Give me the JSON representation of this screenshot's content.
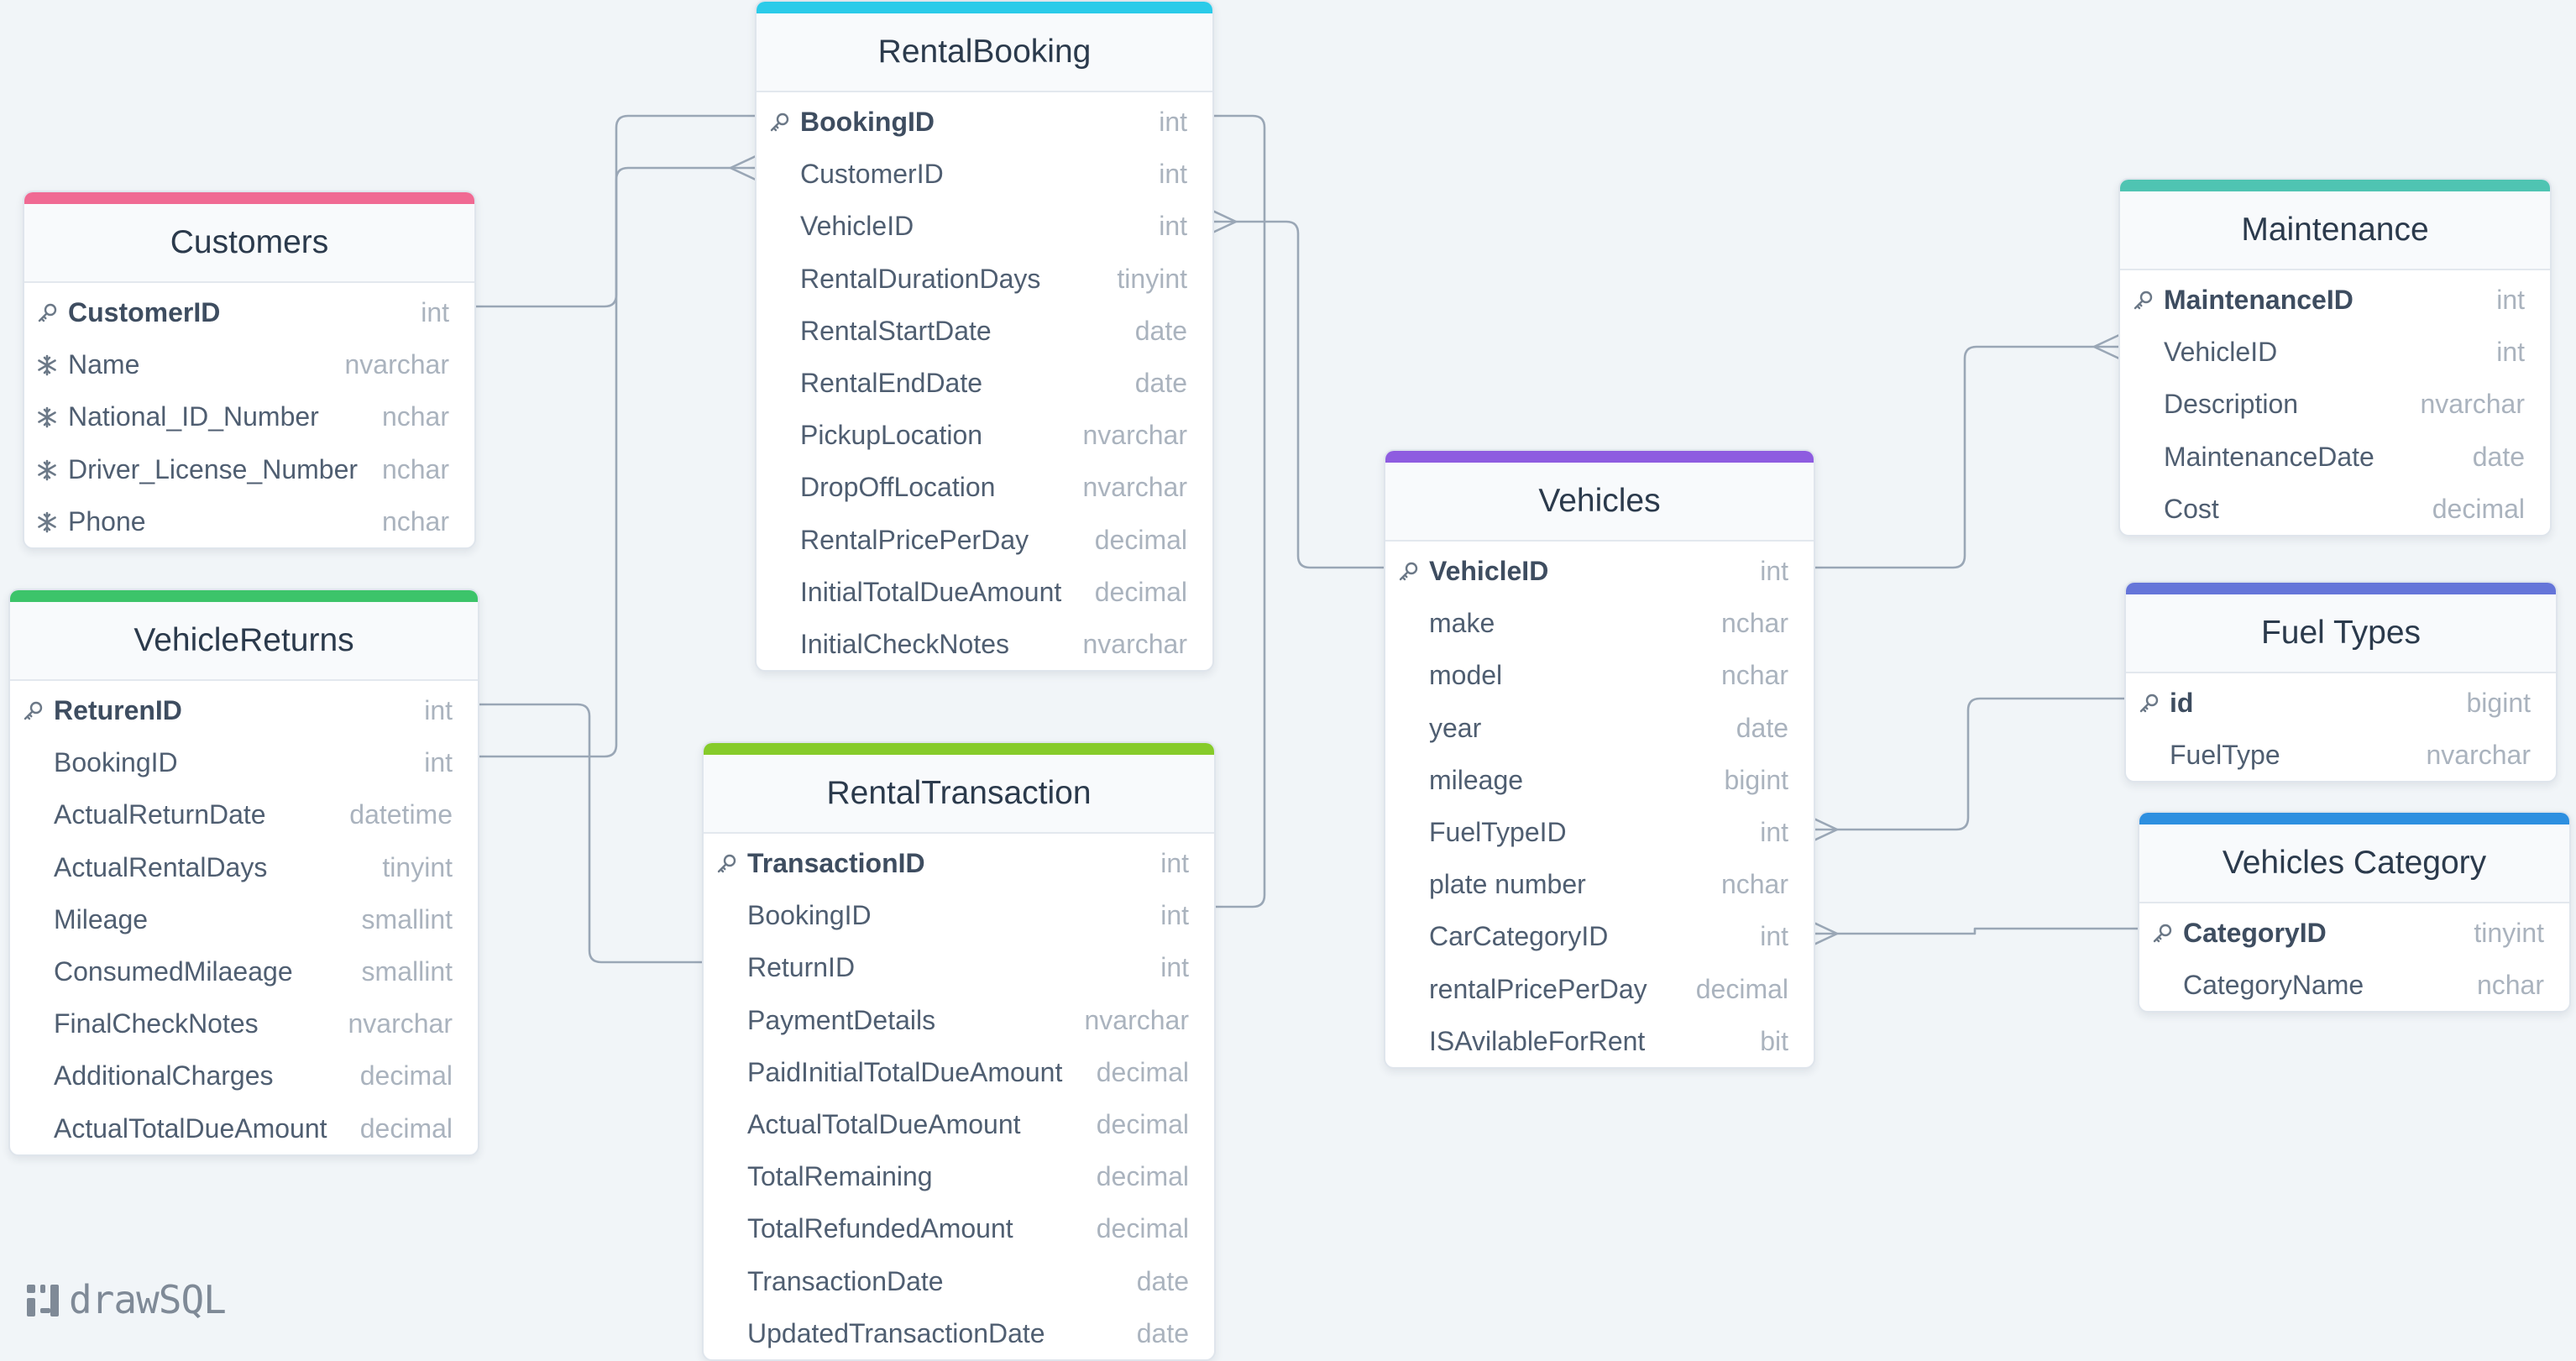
{
  "app": {
    "brand": "drawSQL"
  },
  "colors": {
    "customers": "#f06a93",
    "vehiclereturns": "#3cc46a",
    "rentalbooking": "#2bcbe9",
    "rentaltransaction": "#86cb2a",
    "vehicles": "#8e5ce0",
    "maintenance": "#4fc4b2",
    "fueltypes": "#6575d9",
    "vehiclescategory": "#2d8fe0",
    "connector": "#9aa7b6"
  },
  "tables": [
    {
      "id": "rentalbooking",
      "name": "RentalBooking",
      "fields": [
        {
          "name": "BookingID",
          "type": "int",
          "pk": true
        },
        {
          "name": "CustomerID",
          "type": "int"
        },
        {
          "name": "VehicleID",
          "type": "int"
        },
        {
          "name": "RentalDurationDays",
          "type": "tinyint"
        },
        {
          "name": "RentalStartDate",
          "type": "date"
        },
        {
          "name": "RentalEndDate",
          "type": "date"
        },
        {
          "name": "PickupLocation",
          "type": "nvarchar"
        },
        {
          "name": "DropOffLocation",
          "type": "nvarchar"
        },
        {
          "name": "RentalPricePerDay",
          "type": "decimal"
        },
        {
          "name": "InitialTotalDueAmount",
          "type": "decimal"
        },
        {
          "name": "InitialCheckNotes",
          "type": "nvarchar"
        }
      ]
    },
    {
      "id": "customers",
      "name": "Customers",
      "fields": [
        {
          "name": "CustomerID",
          "type": "int",
          "pk": true
        },
        {
          "name": "Name",
          "type": "nvarchar",
          "idx": true
        },
        {
          "name": "National_ID_Number",
          "type": "nchar",
          "idx": true
        },
        {
          "name": "Driver_License_Number",
          "type": "nchar",
          "idx": true
        },
        {
          "name": "Phone",
          "type": "nchar",
          "idx": true
        }
      ]
    },
    {
      "id": "vehiclereturns",
      "name": "VehicleReturns",
      "fields": [
        {
          "name": "ReturenID",
          "type": "int",
          "pk": true
        },
        {
          "name": "BookingID",
          "type": "int"
        },
        {
          "name": "ActualReturnDate",
          "type": "datetime"
        },
        {
          "name": "ActualRentalDays",
          "type": "tinyint"
        },
        {
          "name": "Mileage",
          "type": "smallint"
        },
        {
          "name": "ConsumedMilaeage",
          "type": "smallint"
        },
        {
          "name": "FinalCheckNotes",
          "type": "nvarchar"
        },
        {
          "name": "AdditionalCharges",
          "type": "decimal"
        },
        {
          "name": "ActualTotalDueAmount",
          "type": "decimal"
        }
      ]
    },
    {
      "id": "rentaltransaction",
      "name": "RentalTransaction",
      "fields": [
        {
          "name": "TransactionID",
          "type": "int",
          "pk": true
        },
        {
          "name": "BookingID",
          "type": "int"
        },
        {
          "name": "ReturnID",
          "type": "int"
        },
        {
          "name": "PaymentDetails",
          "type": "nvarchar"
        },
        {
          "name": "PaidInitialTotalDueAmount",
          "type": "decimal"
        },
        {
          "name": "ActualTotalDueAmount",
          "type": "decimal"
        },
        {
          "name": "TotalRemaining",
          "type": "decimal"
        },
        {
          "name": "TotalRefundedAmount",
          "type": "decimal"
        },
        {
          "name": "TransactionDate",
          "type": "date"
        },
        {
          "name": "UpdatedTransactionDate",
          "type": "date"
        }
      ]
    },
    {
      "id": "vehicles",
      "name": "Vehicles",
      "fields": [
        {
          "name": "VehicleID",
          "type": "int",
          "pk": true
        },
        {
          "name": "make",
          "type": "nchar"
        },
        {
          "name": "model",
          "type": "nchar"
        },
        {
          "name": "year",
          "type": "date"
        },
        {
          "name": "mileage",
          "type": "bigint"
        },
        {
          "name": "FuelTypeID",
          "type": "int"
        },
        {
          "name": "plate number",
          "type": "nchar"
        },
        {
          "name": "CarCategoryID",
          "type": "int"
        },
        {
          "name": "rentalPricePerDay",
          "type": "decimal"
        },
        {
          "name": "ISAvilableForRent",
          "type": "bit"
        }
      ]
    },
    {
      "id": "maintenance",
      "name": "Maintenance",
      "fields": [
        {
          "name": "MaintenanceID",
          "type": "int",
          "pk": true
        },
        {
          "name": "VehicleID",
          "type": "int"
        },
        {
          "name": "Description",
          "type": "nvarchar"
        },
        {
          "name": "MaintenanceDate",
          "type": "date"
        },
        {
          "name": "Cost",
          "type": "decimal"
        }
      ]
    },
    {
      "id": "fueltypes",
      "name": "Fuel Types",
      "fields": [
        {
          "name": "id",
          "type": "bigint",
          "pk": true
        },
        {
          "name": "FuelType",
          "type": "nvarchar"
        }
      ]
    },
    {
      "id": "vehiclescategory",
      "name": "Vehicles Category",
      "fields": [
        {
          "name": "CategoryID",
          "type": "tinyint",
          "pk": true
        },
        {
          "name": "CategoryName",
          "type": "nchar"
        }
      ]
    }
  ]
}
